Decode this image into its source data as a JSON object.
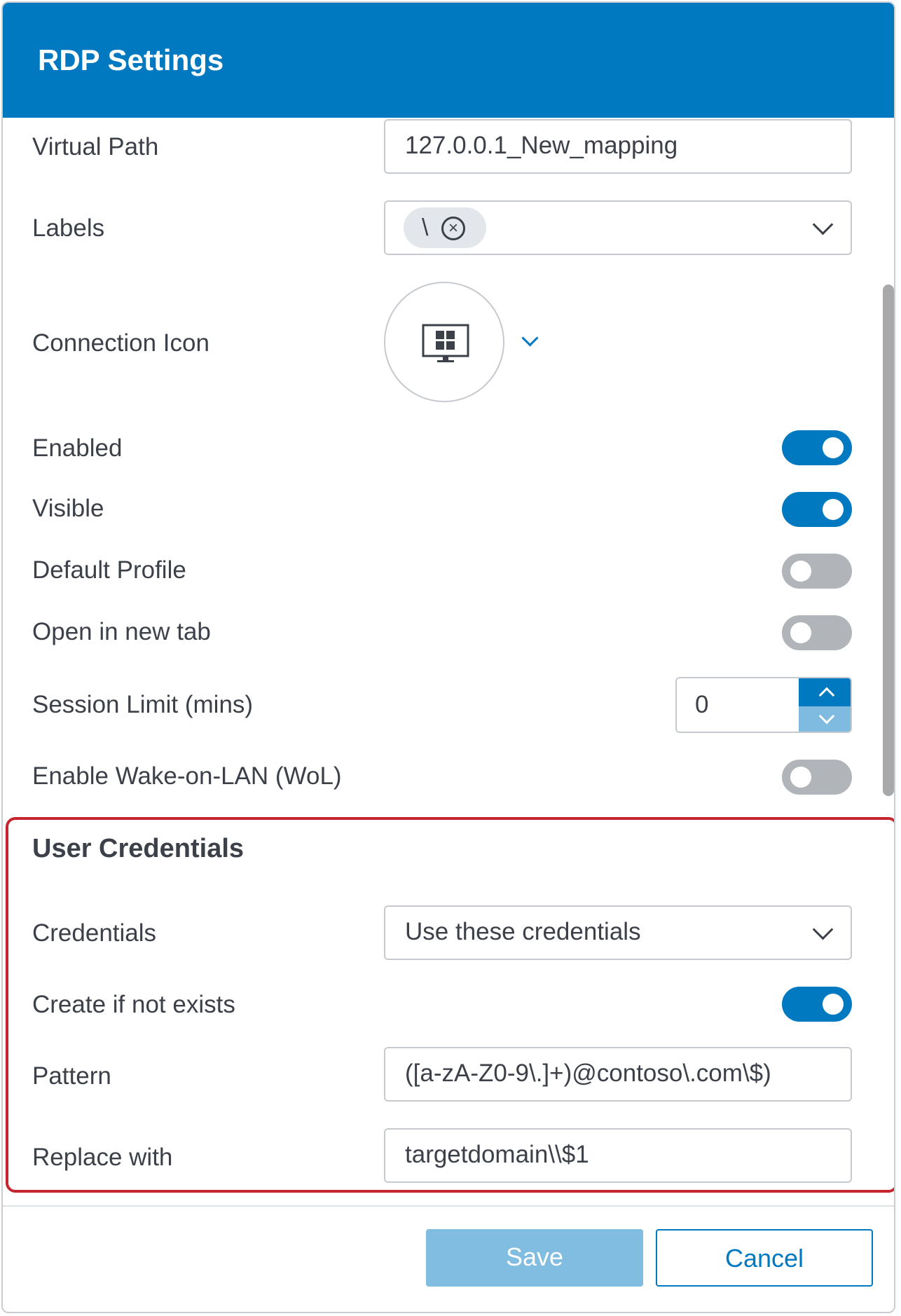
{
  "dialog": {
    "title": "RDP Settings",
    "accent_color": "#0079c1"
  },
  "fields": {
    "virtual_path": {
      "label": "Virtual Path",
      "value": "127.0.0.1_New_mapping"
    },
    "labels": {
      "label": "Labels",
      "chips": [
        {
          "text": "\\",
          "remove_icon": "circle-x-icon"
        }
      ]
    },
    "connection_icon": {
      "label": "Connection Icon",
      "icon": "windows-monitor-icon"
    },
    "enabled": {
      "label": "Enabled",
      "on": true
    },
    "visible": {
      "label": "Visible",
      "on": true
    },
    "default_profile": {
      "label": "Default Profile",
      "on": false
    },
    "open_new_tab": {
      "label": "Open in new tab",
      "on": false
    },
    "session_limit": {
      "label": "Session Limit (mins)",
      "value": "0"
    },
    "wol": {
      "label": "Enable Wake-on-LAN (WoL)",
      "on": false
    }
  },
  "user_credentials": {
    "title": "User Credentials",
    "credentials": {
      "label": "Credentials",
      "value": "Use these credentials"
    },
    "create_if_not_exists": {
      "label": "Create if not exists",
      "on": true
    },
    "pattern": {
      "label": "Pattern",
      "value": "([a-zA-Z0-9\\.]+)@contoso\\.com\\$)"
    },
    "replace_with": {
      "label": "Replace with",
      "value": "targetdomain\\\\$1"
    },
    "highlight_color": "#c7252e"
  },
  "footer": {
    "save_label": "Save",
    "cancel_label": "Cancel"
  }
}
